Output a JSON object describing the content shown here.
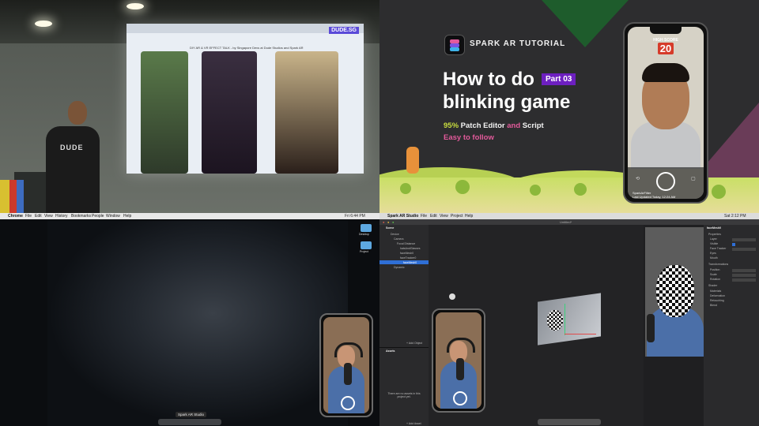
{
  "q1_talk": {
    "screen_title": "DIY AR & VR EFFECT TALK - by Singapore Devs at Dude Studios and Spark AR",
    "dude_tag": "DUDE.SG",
    "shirt_text": "DUDE"
  },
  "q2_tutorial": {
    "brand": "SPARK AR TUTORIAL",
    "headline_1": "How to do",
    "part_badge": "Part 03",
    "headline_2": "blinking game",
    "sub_1_pct": "95%",
    "sub_1_a": "Patch Editor",
    "sub_1_and": "and",
    "sub_1_b": "Script",
    "sub_2": "Easy to follow",
    "phone": {
      "high_score_label": "HIGH SCORE",
      "score": "20",
      "caption_1": "SparkArFilter",
      "caption_2": "Last Updated Today, 12:24 AM"
    },
    "colors": {
      "accent_purple": "#6d1fc0",
      "accent_green": "#c9de3e",
      "accent_pink": "#e35a9b"
    }
  },
  "q3_desktop": {
    "menubar": [
      "Chrome",
      "File",
      "Edit",
      "View",
      "History",
      "Bookmarks",
      "People",
      "Window",
      "Help"
    ],
    "clock": "Fri 6:44 PM",
    "tooltip": "Spark AR Studio",
    "folders": [
      "Desktop",
      "Project"
    ]
  },
  "q4_spark": {
    "menubar": [
      "Spark AR Studio",
      "File",
      "Edit",
      "View",
      "Project",
      "Help"
    ],
    "clock": "Sat 2:12 PM",
    "window_title": "Untitled*",
    "scene": {
      "header": "Scene",
      "items": [
        "Device",
        "Camera",
        "Focal Distance",
        "hatsAndGlasses",
        "faceMesh0",
        "faceTracker0",
        "faceMesh0",
        "Dynamic"
      ],
      "selected_index": 6,
      "add_object": "+ Add Object"
    },
    "assets": {
      "header": "Assets",
      "empty_title": "There are no assets in this project yet.",
      "add_asset": "+ Add Asset"
    },
    "inspector": {
      "object": "faceMesh0",
      "sections": [
        "Properties",
        "Layer",
        "Visible",
        "Face Tracker",
        "Eyes",
        "Mouth",
        "Transformations",
        "Position",
        "Scale",
        "Rotation",
        "Shader",
        "Materials",
        "Deformation",
        "Retouching",
        "Blend"
      ]
    }
  }
}
